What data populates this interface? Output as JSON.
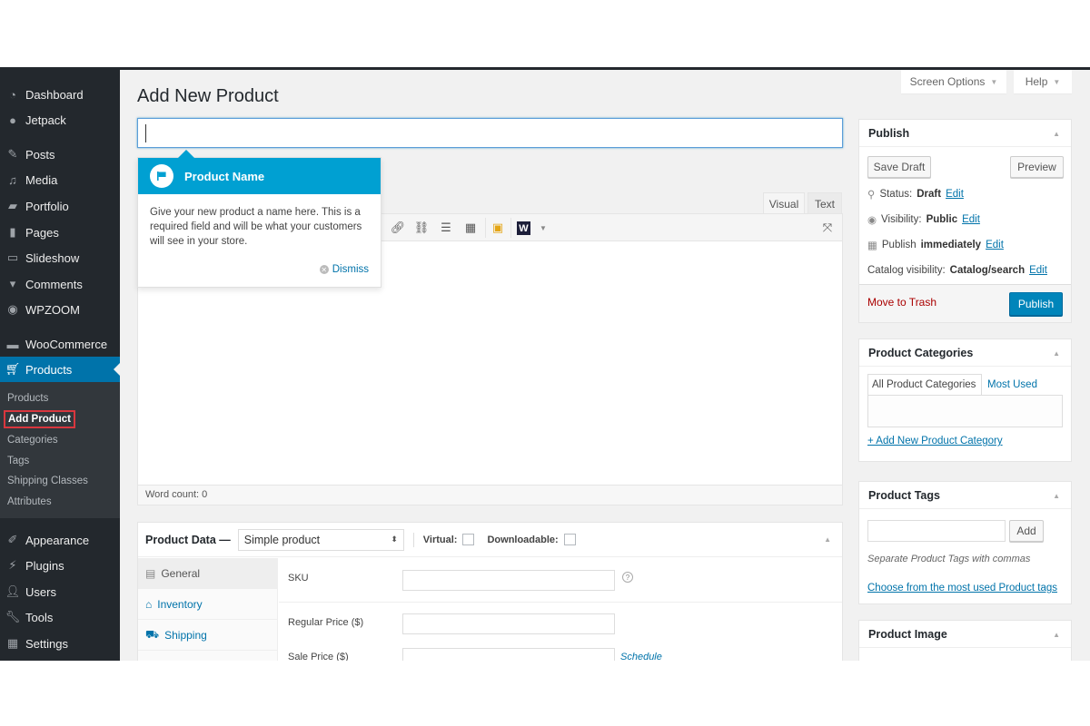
{
  "sidebar": {
    "items": [
      {
        "label": "Dashboard",
        "icon": "dashboard-icon"
      },
      {
        "label": "Jetpack",
        "icon": "jetpack-icon"
      },
      {
        "label": "Posts",
        "icon": "pin-icon"
      },
      {
        "label": "Media",
        "icon": "media-icon"
      },
      {
        "label": "Portfolio",
        "icon": "folder-icon"
      },
      {
        "label": "Pages",
        "icon": "pages-icon"
      },
      {
        "label": "Slideshow",
        "icon": "slideshow-icon"
      },
      {
        "label": "Comments",
        "icon": "comment-icon"
      },
      {
        "label": "WPZOOM",
        "icon": "wpzoom-icon"
      },
      {
        "label": "WooCommerce",
        "icon": "woocommerce-icon"
      },
      {
        "label": "Products",
        "icon": "cart-icon",
        "active": true
      },
      {
        "label": "Appearance",
        "icon": "paintbrush-icon"
      },
      {
        "label": "Plugins",
        "icon": "plugin-icon"
      },
      {
        "label": "Users",
        "icon": "user-icon"
      },
      {
        "label": "Tools",
        "icon": "wrench-icon"
      },
      {
        "label": "Settings",
        "icon": "settings-icon"
      }
    ],
    "submenu": [
      {
        "label": "Products"
      },
      {
        "label": "Add Product",
        "current": true
      },
      {
        "label": "Categories"
      },
      {
        "label": "Tags"
      },
      {
        "label": "Shipping Classes"
      },
      {
        "label": "Attributes"
      }
    ]
  },
  "header": {
    "title": "Add New Product",
    "screen_options": "Screen Options",
    "help": "Help"
  },
  "title_input": {
    "value": "",
    "placeholder": ""
  },
  "pointer": {
    "title": "Product Name",
    "body": "Give your new product a name here. This is a required field and will be what your customers will see in your store.",
    "dismiss": "Dismiss"
  },
  "editor": {
    "tabs": [
      "Visual",
      "Text"
    ],
    "active_tab": "Visual",
    "word_count": "Word count: 0"
  },
  "product_data": {
    "label": "Product Data —",
    "type": "Simple product",
    "virtual_label": "Virtual:",
    "downloadable_label": "Downloadable:",
    "virtual_checked": false,
    "downloadable_checked": false,
    "tabs": [
      {
        "label": "General",
        "icon": "general-icon",
        "active": true
      },
      {
        "label": "Inventory",
        "icon": "inventory-icon"
      },
      {
        "label": "Shipping",
        "icon": "truck-icon"
      }
    ],
    "fields": {
      "sku": "SKU",
      "regular_price": "Regular Price ($)",
      "sale_price": "Sale Price ($)",
      "schedule": "Schedule"
    }
  },
  "publish": {
    "title": "Publish",
    "save_draft": "Save Draft",
    "preview": "Preview",
    "status_label": "Status:",
    "status_value": "Draft",
    "visibility_label": "Visibility:",
    "visibility_value": "Public",
    "publish_label": "Publish",
    "publish_value": "immediately",
    "catalog_label": "Catalog visibility:",
    "catalog_value": "Catalog/search",
    "edit": "Edit",
    "trash": "Move to Trash",
    "publish_button": "Publish"
  },
  "categories": {
    "title": "Product Categories",
    "tab_all": "All Product Categories",
    "tab_most": "Most Used",
    "add_new": "+ Add New Product Category"
  },
  "tags": {
    "title": "Product Tags",
    "add": "Add",
    "hint": "Separate Product Tags with commas",
    "choose": "Choose from the most used Product tags"
  },
  "image": {
    "title": "Product Image"
  }
}
